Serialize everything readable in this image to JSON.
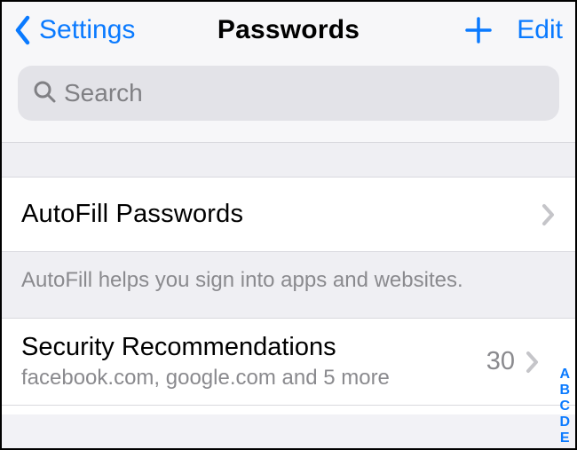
{
  "nav": {
    "back_label": "Settings",
    "title": "Passwords",
    "edit_label": "Edit"
  },
  "search": {
    "placeholder": "Search",
    "value": ""
  },
  "autofill": {
    "label": "AutoFill Passwords",
    "footer": "AutoFill helps you sign into apps and websites."
  },
  "security": {
    "title": "Security Recommendations",
    "subtitle": "facebook.com, google.com and 5 more",
    "count": "30"
  },
  "index_letters": [
    "A",
    "B",
    "C",
    "D",
    "E"
  ]
}
